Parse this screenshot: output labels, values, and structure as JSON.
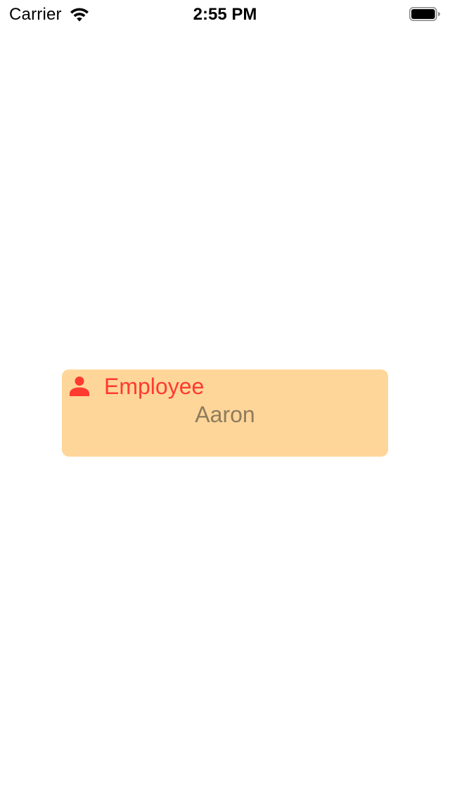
{
  "status_bar": {
    "carrier": "Carrier",
    "time": "2:55 PM",
    "wifi_icon": "wifi-icon",
    "battery_icon": "battery-icon"
  },
  "card": {
    "icon": "person-icon",
    "title": "Employee",
    "value": "Aaron",
    "background_color": "#ffd699",
    "title_color": "#ff3b30",
    "value_color": "#8e7c5c"
  }
}
